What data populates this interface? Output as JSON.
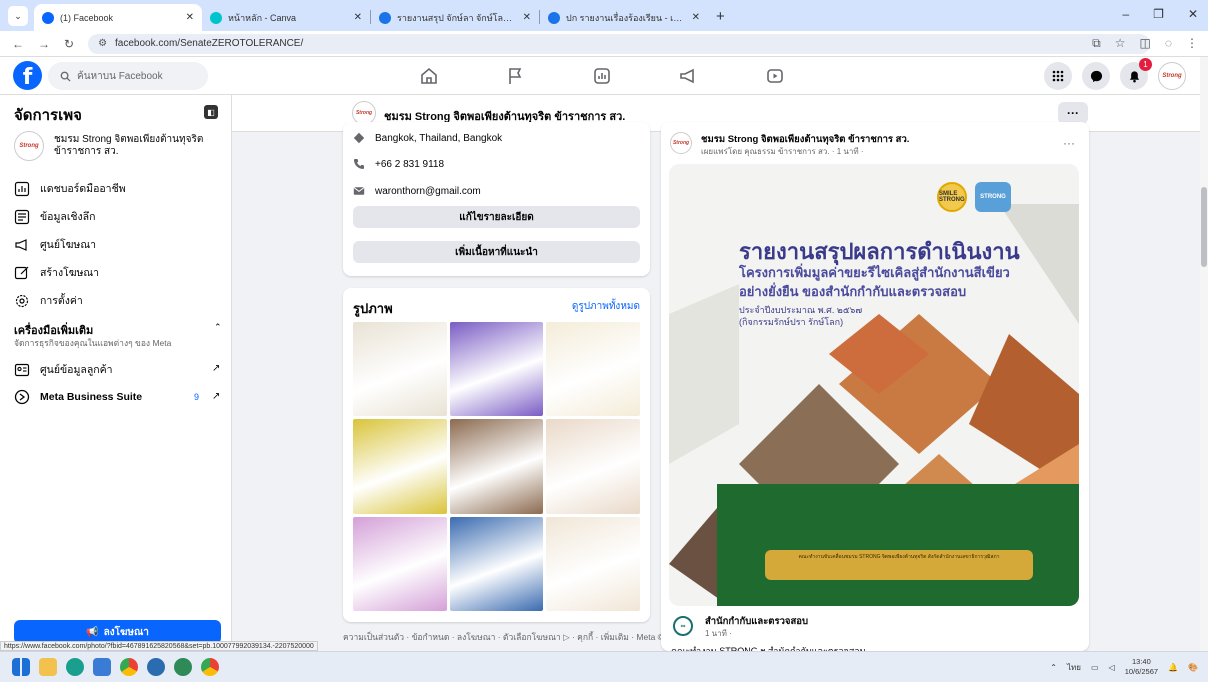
{
  "browser": {
    "tabs": [
      {
        "title": "(1) Facebook",
        "fav_color": "#0866ff",
        "active": true
      },
      {
        "title": "หน้าหลัก - Canva",
        "fav_color": "#00c4cc",
        "active": false
      },
      {
        "title": "รายงานสรุป จักษ์ลา จักษ์โลก - เอกส",
        "fav_color": "#1a73e8",
        "active": false
      },
      {
        "title": "ปก รายงานเรื่องร้องเรียน - เอกสาร (",
        "fav_color": "#1a73e8",
        "active": false
      }
    ],
    "url": "facebook.com/SenateZEROTOLERANCE/",
    "new_tab": "+",
    "status_url": "https://www.facebook.com/photo/?fbid=467891625820568&set=pb.100077992039134.-2207520000"
  },
  "fb": {
    "search_placeholder": "ค้นหาบน Facebook",
    "notif_count": "1",
    "avatar_text": "Strong"
  },
  "sidebar": {
    "title": "จัดการเพจ",
    "page_name": "ชมรม Strong จิตพอเพียงต้านทุจริต ข้าราชการ สว.",
    "page_avatar": "Strong",
    "items": [
      {
        "label": "แดชบอร์ดมืออาชีพ",
        "icon": "dashboard-icon"
      },
      {
        "label": "ข้อมูลเชิงลึก",
        "icon": "insights-icon"
      },
      {
        "label": "ศูนย์โฆษณา",
        "icon": "megaphone-icon"
      },
      {
        "label": "สร้างโฆษณา",
        "icon": "edit-icon"
      },
      {
        "label": "การตั้งค่า",
        "icon": "gear-icon"
      }
    ],
    "tools_title": "เครื่องมือเพิ่มเติม",
    "tools_sub": "จัดการธุรกิจของคุณในแอพต่างๆ ของ Meta",
    "tool_items": [
      {
        "label": "ศูนย์ข้อมูลลูกค้า"
      },
      {
        "label": "Meta Business Suite",
        "count": "9"
      }
    ],
    "promote_label": "ลงโฆษณา"
  },
  "page_header": {
    "name": "ชมรม Strong จิตพอเพียงต้านทุจริต ข้าราชการ สว."
  },
  "intro": {
    "location": "Bangkok, Thailand, Bangkok",
    "phone": "+66 2 831 9118",
    "email": "waronthorn@gmail.com",
    "edit_details": "แก้ไขรายละเอียด",
    "add_featured": "เพิ่มเนื้อหาที่แนะนำ"
  },
  "photos": {
    "title": "รูปภาพ",
    "see_all": "ดูรูปภาพทั้งหมด",
    "tiles": [
      "#e9e2d4",
      "#7a5cc4",
      "#f4ecd8",
      "#d9c43a",
      "#8b6a4f",
      "#e9d9c8",
      "#d4a0d8",
      "#3a6bb0",
      "#f0e6d6"
    ]
  },
  "footer": "ความเป็นส่วนตัว · ข้อกำหนด · ลงโฆษณา · ตัวเลือกโฆษณา ▷ · คุกกี้ · เพิ่มเติม · Meta © 2024",
  "post": {
    "author": "ชมรม Strong จิตพอเพียงต้านทุจริต ข้าราชการ สว.",
    "meta": "เผยแพร่โดย คุณธรรม ข้าราชการ สว. · 1 นาที ·",
    "poster": {
      "title": "รายงานสรุปผลการดำเนินงาน",
      "line1": "โครงการเพิ่มมูลค่าขยะรีไซเคิลสู่สำนักงานสีเขียว",
      "line2": "อย่างยั่งยืน ของสำนักกำกับและตรวจสอบ",
      "line3": "ประจำปีงบประมาณ พ.ศ. ๒๕๖๗",
      "line4": "(กิจกรรมรักษ์ปรา รักษ์โลก)",
      "logo1": "SMILE STRONG",
      "logo2": "STRONG",
      "banner": "คณะทำงานขับเคลื่อนชมรม STRONG จิตพอเพียงต้านทุจริต สังกัดสำนักงานเลขาธิการวุฒิสภา"
    },
    "shared_from": "สำนักกำกับและตรวจสอบ",
    "shared_meta": "1 นาที ·",
    "caption": "คณะทำงาน STRONG ฯ สำนักกำกับและตรวจสอบ"
  },
  "taskbar": {
    "lang": "ไทย",
    "time": "13:40",
    "date": "10/6/2567"
  }
}
